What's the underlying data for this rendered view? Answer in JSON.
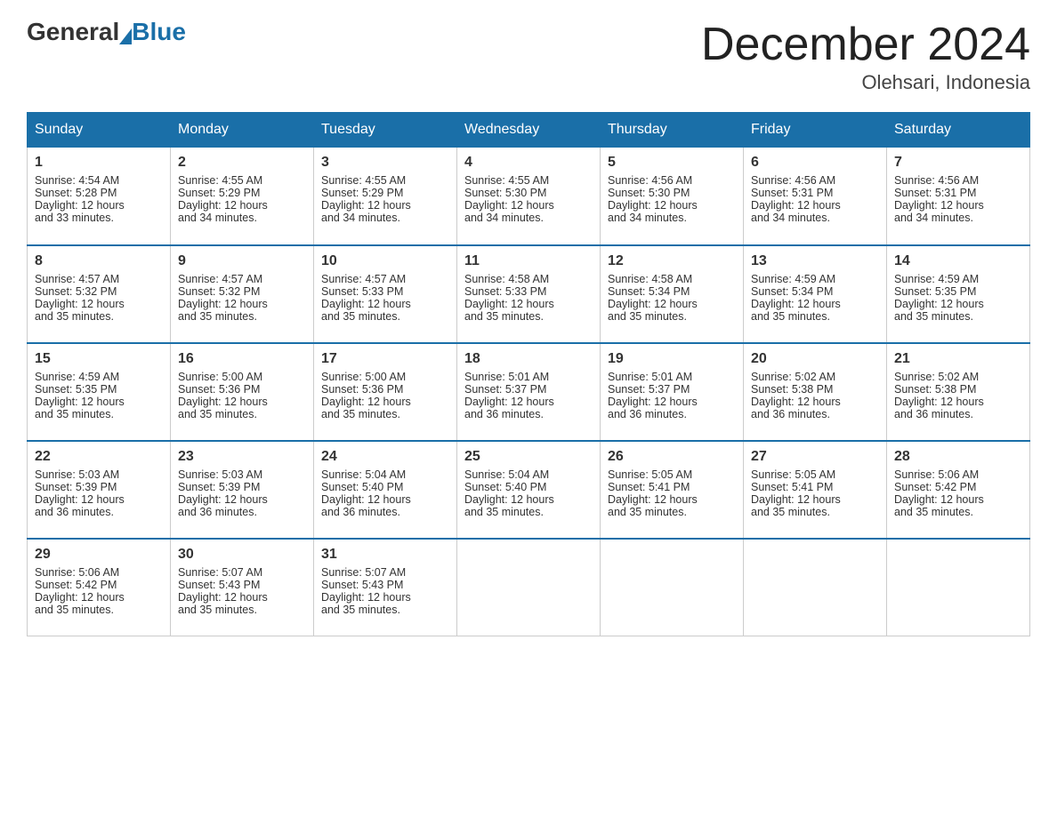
{
  "header": {
    "logo_general": "General",
    "logo_blue": "Blue",
    "month_title": "December 2024",
    "location": "Olehsari, Indonesia"
  },
  "days_of_week": [
    "Sunday",
    "Monday",
    "Tuesday",
    "Wednesday",
    "Thursday",
    "Friday",
    "Saturday"
  ],
  "weeks": [
    [
      {
        "day": "1",
        "sunrise": "4:54 AM",
        "sunset": "5:28 PM",
        "daylight": "12 hours and 33 minutes."
      },
      {
        "day": "2",
        "sunrise": "4:55 AM",
        "sunset": "5:29 PM",
        "daylight": "12 hours and 34 minutes."
      },
      {
        "day": "3",
        "sunrise": "4:55 AM",
        "sunset": "5:29 PM",
        "daylight": "12 hours and 34 minutes."
      },
      {
        "day": "4",
        "sunrise": "4:55 AM",
        "sunset": "5:30 PM",
        "daylight": "12 hours and 34 minutes."
      },
      {
        "day": "5",
        "sunrise": "4:56 AM",
        "sunset": "5:30 PM",
        "daylight": "12 hours and 34 minutes."
      },
      {
        "day": "6",
        "sunrise": "4:56 AM",
        "sunset": "5:31 PM",
        "daylight": "12 hours and 34 minutes."
      },
      {
        "day": "7",
        "sunrise": "4:56 AM",
        "sunset": "5:31 PM",
        "daylight": "12 hours and 34 minutes."
      }
    ],
    [
      {
        "day": "8",
        "sunrise": "4:57 AM",
        "sunset": "5:32 PM",
        "daylight": "12 hours and 35 minutes."
      },
      {
        "day": "9",
        "sunrise": "4:57 AM",
        "sunset": "5:32 PM",
        "daylight": "12 hours and 35 minutes."
      },
      {
        "day": "10",
        "sunrise": "4:57 AM",
        "sunset": "5:33 PM",
        "daylight": "12 hours and 35 minutes."
      },
      {
        "day": "11",
        "sunrise": "4:58 AM",
        "sunset": "5:33 PM",
        "daylight": "12 hours and 35 minutes."
      },
      {
        "day": "12",
        "sunrise": "4:58 AM",
        "sunset": "5:34 PM",
        "daylight": "12 hours and 35 minutes."
      },
      {
        "day": "13",
        "sunrise": "4:59 AM",
        "sunset": "5:34 PM",
        "daylight": "12 hours and 35 minutes."
      },
      {
        "day": "14",
        "sunrise": "4:59 AM",
        "sunset": "5:35 PM",
        "daylight": "12 hours and 35 minutes."
      }
    ],
    [
      {
        "day": "15",
        "sunrise": "4:59 AM",
        "sunset": "5:35 PM",
        "daylight": "12 hours and 35 minutes."
      },
      {
        "day": "16",
        "sunrise": "5:00 AM",
        "sunset": "5:36 PM",
        "daylight": "12 hours and 35 minutes."
      },
      {
        "day": "17",
        "sunrise": "5:00 AM",
        "sunset": "5:36 PM",
        "daylight": "12 hours and 35 minutes."
      },
      {
        "day": "18",
        "sunrise": "5:01 AM",
        "sunset": "5:37 PM",
        "daylight": "12 hours and 36 minutes."
      },
      {
        "day": "19",
        "sunrise": "5:01 AM",
        "sunset": "5:37 PM",
        "daylight": "12 hours and 36 minutes."
      },
      {
        "day": "20",
        "sunrise": "5:02 AM",
        "sunset": "5:38 PM",
        "daylight": "12 hours and 36 minutes."
      },
      {
        "day": "21",
        "sunrise": "5:02 AM",
        "sunset": "5:38 PM",
        "daylight": "12 hours and 36 minutes."
      }
    ],
    [
      {
        "day": "22",
        "sunrise": "5:03 AM",
        "sunset": "5:39 PM",
        "daylight": "12 hours and 36 minutes."
      },
      {
        "day": "23",
        "sunrise": "5:03 AM",
        "sunset": "5:39 PM",
        "daylight": "12 hours and 36 minutes."
      },
      {
        "day": "24",
        "sunrise": "5:04 AM",
        "sunset": "5:40 PM",
        "daylight": "12 hours and 36 minutes."
      },
      {
        "day": "25",
        "sunrise": "5:04 AM",
        "sunset": "5:40 PM",
        "daylight": "12 hours and 35 minutes."
      },
      {
        "day": "26",
        "sunrise": "5:05 AM",
        "sunset": "5:41 PM",
        "daylight": "12 hours and 35 minutes."
      },
      {
        "day": "27",
        "sunrise": "5:05 AM",
        "sunset": "5:41 PM",
        "daylight": "12 hours and 35 minutes."
      },
      {
        "day": "28",
        "sunrise": "5:06 AM",
        "sunset": "5:42 PM",
        "daylight": "12 hours and 35 minutes."
      }
    ],
    [
      {
        "day": "29",
        "sunrise": "5:06 AM",
        "sunset": "5:42 PM",
        "daylight": "12 hours and 35 minutes."
      },
      {
        "day": "30",
        "sunrise": "5:07 AM",
        "sunset": "5:43 PM",
        "daylight": "12 hours and 35 minutes."
      },
      {
        "day": "31",
        "sunrise": "5:07 AM",
        "sunset": "5:43 PM",
        "daylight": "12 hours and 35 minutes."
      },
      null,
      null,
      null,
      null
    ]
  ]
}
